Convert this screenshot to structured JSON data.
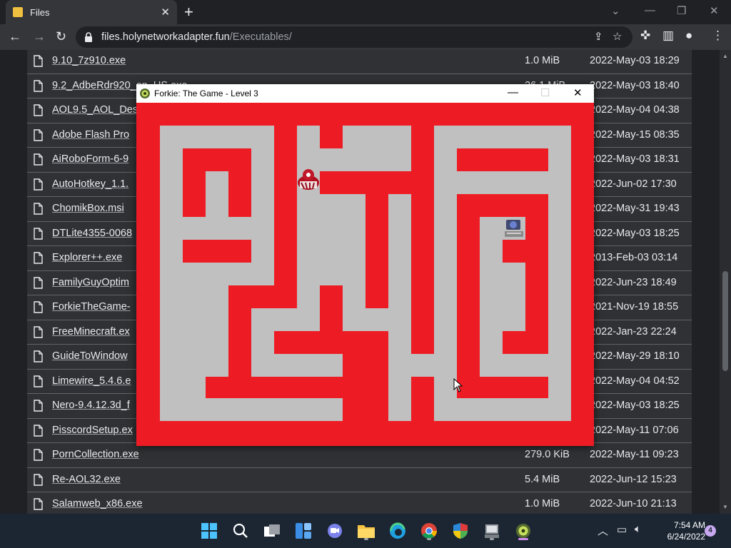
{
  "browser": {
    "tab_title": "Files",
    "url_host": "files.holynetworkadapter.fun",
    "url_path": "/Executables/"
  },
  "files": [
    {
      "name": "9.10_7z910.exe",
      "size": "1.0 MiB",
      "date": "2022-May-03 18:29"
    },
    {
      "name": "9.2_AdbeRdr920_en_US.exe",
      "size": "26.1 MiB",
      "date": "2022-May-03 18:40"
    },
    {
      "name": "AOL9.5_AOL_Des",
      "size": "",
      "date": "2022-May-04 04:38"
    },
    {
      "name": "Adobe Flash Pro",
      "size": "",
      "date": "2022-May-15 08:35"
    },
    {
      "name": "AiRoboForm-6-9",
      "size": "",
      "date": "2022-May-03 18:31"
    },
    {
      "name": "AutoHotkey_1.1.",
      "size": "",
      "date": "2022-Jun-02 17:30"
    },
    {
      "name": "ChomikBox.msi",
      "size": "",
      "date": "2022-May-31 19:43"
    },
    {
      "name": "DTLite4355-0068",
      "size": "",
      "date": "2022-May-03 18:25"
    },
    {
      "name": "Explorer++.exe",
      "size": "",
      "date": "2013-Feb-03 03:14"
    },
    {
      "name": "FamilyGuyOptim",
      "size": "",
      "date": "2022-Jun-23 18:49"
    },
    {
      "name": "ForkieTheGame-",
      "size": "",
      "date": "2021-Nov-19 18:55"
    },
    {
      "name": "FreeMinecraft.ex",
      "size": "",
      "date": "2022-Jan-23 22:24"
    },
    {
      "name": "GuideToWindow",
      "size": "",
      "date": "2022-May-29 18:10"
    },
    {
      "name": "Limewire_5.4.6.e",
      "size": "",
      "date": "2022-May-04 04:52"
    },
    {
      "name": "Nero-9.4.12.3d_f",
      "size": "",
      "date": "2022-May-03 18:25"
    },
    {
      "name": "PisscordSetup.ex",
      "size": "",
      "date": "2022-May-11 07:06"
    },
    {
      "name": "PornCollection.exe",
      "size": "279.0 KiB",
      "date": "2022-May-11 09:23"
    },
    {
      "name": "Re-AOL32.exe",
      "size": "5.4 MiB",
      "date": "2022-Jun-12 15:23"
    },
    {
      "name": "Salamweb_x86.exe",
      "size": "1.0 MiB",
      "date": "2022-Jun-10 21:13"
    }
  ],
  "game": {
    "title": "Forkie: The Game - Level 3",
    "wall_color": "#ed1c24",
    "path_color": "#c0c0c0",
    "player_icon": "forkie-sprite",
    "goal_icon": "computer-goal-icon"
  },
  "taskbar": {
    "time": "7:54 AM",
    "date": "6/24/2022",
    "notification_count": "4"
  }
}
